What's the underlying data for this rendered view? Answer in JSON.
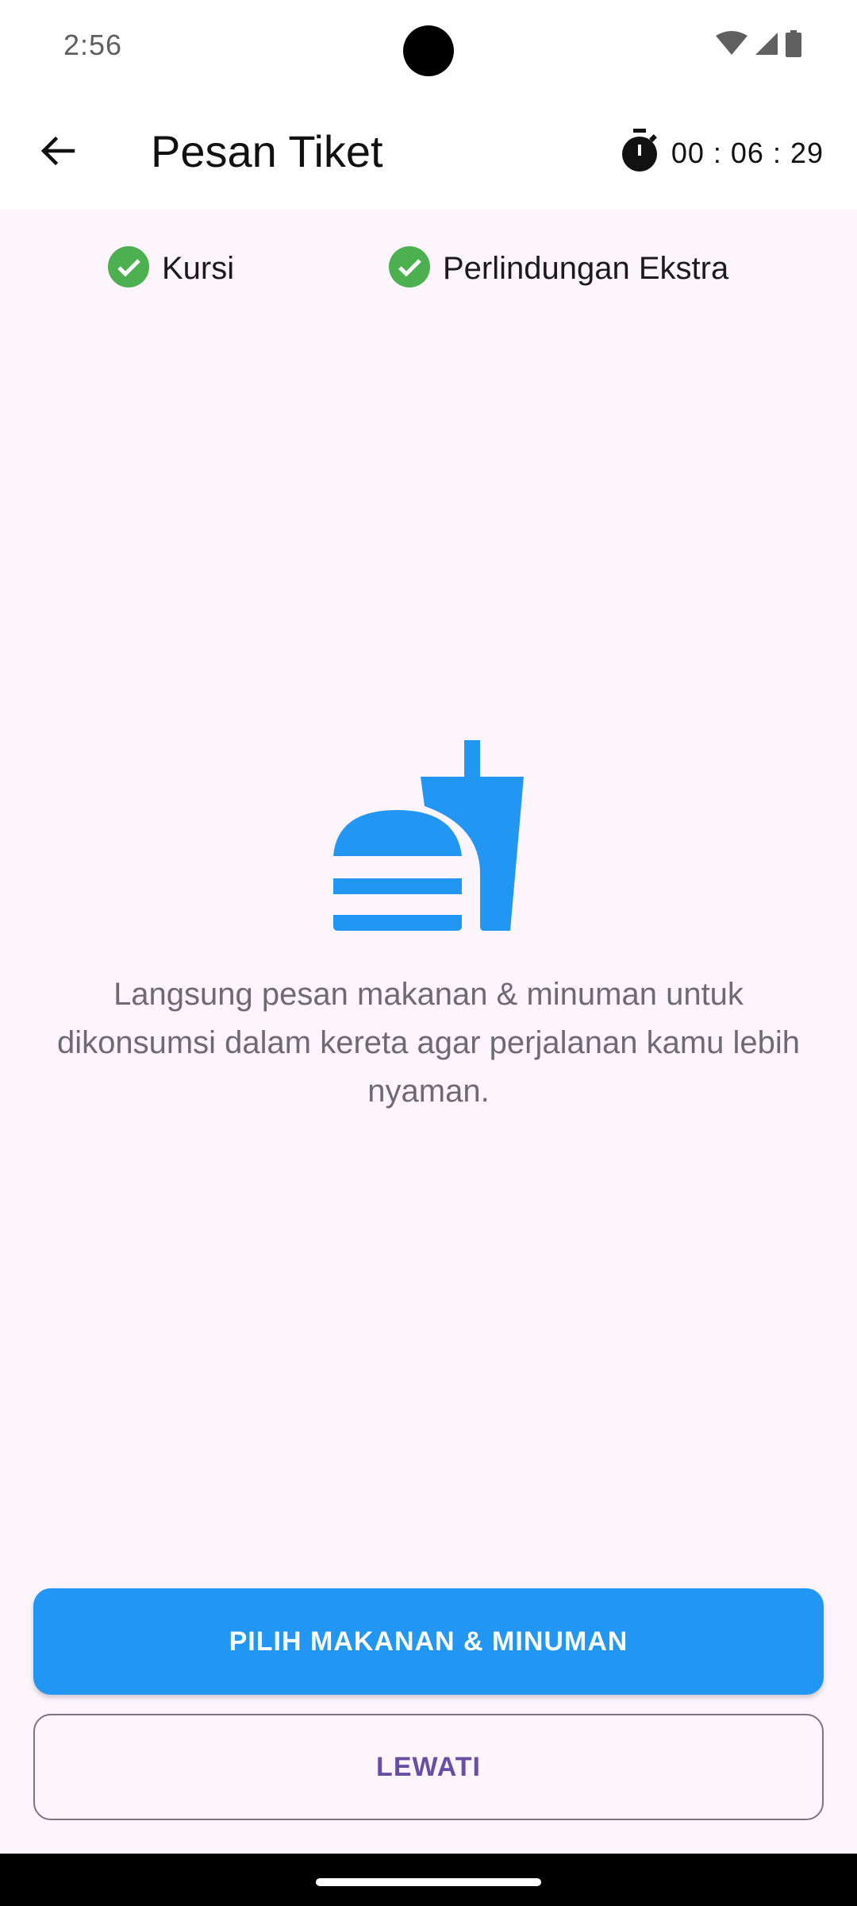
{
  "status_bar": {
    "time": "2:56",
    "icons": [
      "wifi-icon",
      "cellular-signal-icon",
      "battery-icon"
    ]
  },
  "app_bar": {
    "back_icon": "arrow-back-icon",
    "title": "Pesan Tiket",
    "timer_icon": "stopwatch-icon",
    "timer": "00 : 06 : 29"
  },
  "steps": [
    {
      "label": "Kursi",
      "status": "done",
      "icon": "check-circle-icon"
    },
    {
      "label": "Perlindungan Ekstra",
      "status": "done",
      "icon": "check-circle-icon"
    }
  ],
  "main": {
    "illustration_icon": "fastfood-icon",
    "description": "Langsung pesan makanan & minuman untuk dikonsumsi dalam kereta agar perjalanan kamu lebih nyaman."
  },
  "actions": {
    "primary_label": "PILIH MAKANAN & MINUMAN",
    "secondary_label": "LEWATI"
  },
  "colors": {
    "accent": "#2196F3",
    "check": "#4CAF50",
    "background": "#FDF5FC",
    "secondary_text": "#6750A4"
  }
}
